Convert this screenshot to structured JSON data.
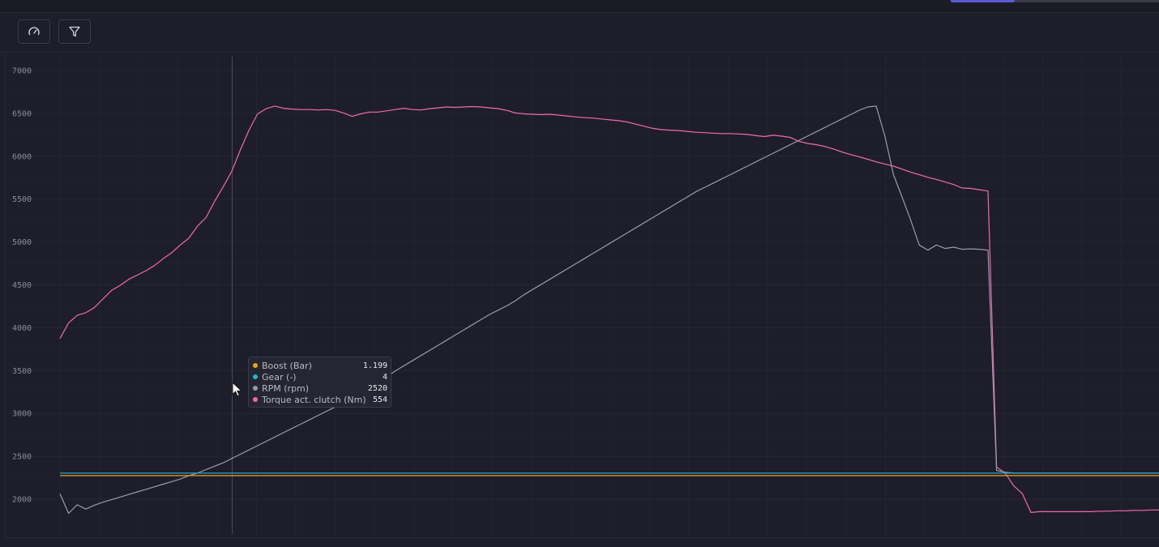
{
  "toolbar": {
    "buttons": [
      {
        "icon": "gauge-icon"
      },
      {
        "icon": "filter-icon"
      }
    ]
  },
  "tooltip": {
    "rows": [
      {
        "label": "Boost (Bar)",
        "value": "1.199",
        "color": "#f0a020"
      },
      {
        "label": "Gear (-)",
        "value": "4",
        "color": "#22b8cf"
      },
      {
        "label": "RPM (rpm)",
        "value": "2520",
        "color": "#9a9aae"
      },
      {
        "label": "Torque act. clutch (Nm)",
        "value": "554",
        "color": "#f06ab0"
      }
    ]
  },
  "chart_data": {
    "type": "line",
    "title": "",
    "xlabel": "",
    "ylabel": "",
    "ylim": [
      1700,
      7150
    ],
    "xlim": [
      0,
      128
    ],
    "y_ticks": [
      2000,
      2500,
      3000,
      3500,
      4000,
      4500,
      5000,
      5500,
      6000,
      6500,
      7000
    ],
    "grid": true,
    "cursor_x": 20,
    "series": [
      {
        "name": "Torque act. clutch (Nm)",
        "color": "#f06ab0",
        "points": [
          [
            0,
            3870
          ],
          [
            1,
            4050
          ],
          [
            2,
            4140
          ],
          [
            3,
            4170
          ],
          [
            4,
            4230
          ],
          [
            5,
            4330
          ],
          [
            6,
            4430
          ],
          [
            7,
            4490
          ],
          [
            8,
            4560
          ],
          [
            9,
            4610
          ],
          [
            10,
            4660
          ],
          [
            11,
            4720
          ],
          [
            12,
            4800
          ],
          [
            13,
            4870
          ],
          [
            14,
            4960
          ],
          [
            15,
            5040
          ],
          [
            16,
            5180
          ],
          [
            17,
            5280
          ],
          [
            18,
            5470
          ],
          [
            19,
            5640
          ],
          [
            20,
            5820
          ],
          [
            21,
            6070
          ],
          [
            22,
            6300
          ],
          [
            23,
            6490
          ],
          [
            24,
            6550
          ],
          [
            25,
            6580
          ],
          [
            26,
            6555
          ],
          [
            27,
            6545
          ],
          [
            28,
            6540
          ],
          [
            29,
            6540
          ],
          [
            30,
            6535
          ],
          [
            31,
            6540
          ],
          [
            32,
            6530
          ],
          [
            33,
            6500
          ],
          [
            34,
            6460
          ],
          [
            35,
            6490
          ],
          [
            36,
            6510
          ],
          [
            37,
            6510
          ],
          [
            38,
            6525
          ],
          [
            39,
            6540
          ],
          [
            40,
            6555
          ],
          [
            41,
            6540
          ],
          [
            42,
            6535
          ],
          [
            43,
            6550
          ],
          [
            44,
            6560
          ],
          [
            45,
            6570
          ],
          [
            46,
            6565
          ],
          [
            47,
            6570
          ],
          [
            48,
            6575
          ],
          [
            49,
            6570
          ],
          [
            50,
            6560
          ],
          [
            51,
            6550
          ],
          [
            52,
            6530
          ],
          [
            53,
            6500
          ],
          [
            54,
            6490
          ],
          [
            55,
            6485
          ],
          [
            56,
            6480
          ],
          [
            57,
            6485
          ],
          [
            58,
            6475
          ],
          [
            59,
            6465
          ],
          [
            60,
            6455
          ],
          [
            61,
            6445
          ],
          [
            62,
            6440
          ],
          [
            63,
            6430
          ],
          [
            64,
            6420
          ],
          [
            65,
            6410
          ],
          [
            66,
            6395
          ],
          [
            67,
            6370
          ],
          [
            68,
            6345
          ],
          [
            69,
            6320
          ],
          [
            70,
            6305
          ],
          [
            71,
            6300
          ],
          [
            72,
            6295
          ],
          [
            73,
            6285
          ],
          [
            74,
            6275
          ],
          [
            75,
            6270
          ],
          [
            76,
            6265
          ],
          [
            77,
            6260
          ],
          [
            78,
            6260
          ],
          [
            79,
            6255
          ],
          [
            80,
            6250
          ],
          [
            81,
            6235
          ],
          [
            82,
            6225
          ],
          [
            83,
            6240
          ],
          [
            84,
            6230
          ],
          [
            85,
            6215
          ],
          [
            86,
            6170
          ],
          [
            87,
            6145
          ],
          [
            88,
            6130
          ],
          [
            89,
            6110
          ],
          [
            90,
            6080
          ],
          [
            91,
            6045
          ],
          [
            92,
            6015
          ],
          [
            93,
            5990
          ],
          [
            94,
            5960
          ],
          [
            95,
            5930
          ],
          [
            96,
            5905
          ],
          [
            97,
            5880
          ],
          [
            98,
            5845
          ],
          [
            99,
            5810
          ],
          [
            100,
            5780
          ],
          [
            101,
            5750
          ],
          [
            102,
            5725
          ],
          [
            103,
            5695
          ],
          [
            104,
            5665
          ],
          [
            105,
            5625
          ],
          [
            106,
            5620
          ],
          [
            107,
            5605
          ],
          [
            108,
            5590
          ],
          [
            109,
            2370
          ],
          [
            110,
            2300
          ],
          [
            111,
            2150
          ],
          [
            112,
            2060
          ],
          [
            113,
            1840
          ],
          [
            114,
            1850
          ],
          [
            115,
            1850
          ],
          [
            116,
            1850
          ],
          [
            117,
            1850
          ],
          [
            118,
            1850
          ],
          [
            119,
            1850
          ],
          [
            120,
            1850
          ],
          [
            121,
            1855
          ],
          [
            122,
            1855
          ],
          [
            123,
            1860
          ],
          [
            124,
            1860
          ],
          [
            125,
            1865
          ],
          [
            126,
            1865
          ],
          [
            127,
            1870
          ],
          [
            128,
            1870
          ]
        ]
      },
      {
        "name": "RPM (rpm)",
        "color": "#9a9aae",
        "points": [
          [
            0,
            2060
          ],
          [
            1,
            1830
          ],
          [
            2,
            1930
          ],
          [
            3,
            1880
          ],
          [
            4,
            1925
          ],
          [
            5,
            1960
          ],
          [
            6,
            1990
          ],
          [
            7,
            2020
          ],
          [
            8,
            2050
          ],
          [
            9,
            2080
          ],
          [
            10,
            2110
          ],
          [
            11,
            2140
          ],
          [
            12,
            2170
          ],
          [
            13,
            2200
          ],
          [
            14,
            2230
          ],
          [
            15,
            2270
          ],
          [
            16,
            2300
          ],
          [
            17,
            2340
          ],
          [
            18,
            2380
          ],
          [
            19,
            2420
          ],
          [
            20,
            2470
          ],
          [
            21,
            2520
          ],
          [
            22,
            2570
          ],
          [
            23,
            2620
          ],
          [
            24,
            2670
          ],
          [
            25,
            2720
          ],
          [
            26,
            2770
          ],
          [
            27,
            2820
          ],
          [
            28,
            2870
          ],
          [
            29,
            2920
          ],
          [
            30,
            2970
          ],
          [
            31,
            3020
          ],
          [
            32,
            3070
          ],
          [
            33,
            3120
          ],
          [
            34,
            3170
          ],
          [
            35,
            3230
          ],
          [
            36,
            3290
          ],
          [
            37,
            3350
          ],
          [
            38,
            3420
          ],
          [
            39,
            3490
          ],
          [
            40,
            3550
          ],
          [
            41,
            3610
          ],
          [
            42,
            3670
          ],
          [
            43,
            3730
          ],
          [
            44,
            3790
          ],
          [
            45,
            3850
          ],
          [
            46,
            3910
          ],
          [
            47,
            3970
          ],
          [
            48,
            4030
          ],
          [
            49,
            4090
          ],
          [
            50,
            4150
          ],
          [
            51,
            4200
          ],
          [
            52,
            4250
          ],
          [
            53,
            4310
          ],
          [
            54,
            4380
          ],
          [
            55,
            4440
          ],
          [
            56,
            4500
          ],
          [
            57,
            4560
          ],
          [
            58,
            4620
          ],
          [
            59,
            4680
          ],
          [
            60,
            4740
          ],
          [
            61,
            4800
          ],
          [
            62,
            4860
          ],
          [
            63,
            4920
          ],
          [
            64,
            4980
          ],
          [
            65,
            5040
          ],
          [
            66,
            5100
          ],
          [
            67,
            5160
          ],
          [
            68,
            5220
          ],
          [
            69,
            5280
          ],
          [
            70,
            5340
          ],
          [
            71,
            5400
          ],
          [
            72,
            5460
          ],
          [
            73,
            5520
          ],
          [
            74,
            5580
          ],
          [
            75,
            5630
          ],
          [
            76,
            5680
          ],
          [
            77,
            5730
          ],
          [
            78,
            5780
          ],
          [
            79,
            5830
          ],
          [
            80,
            5880
          ],
          [
            81,
            5930
          ],
          [
            82,
            5980
          ],
          [
            83,
            6030
          ],
          [
            84,
            6080
          ],
          [
            85,
            6130
          ],
          [
            86,
            6180
          ],
          [
            87,
            6230
          ],
          [
            88,
            6280
          ],
          [
            89,
            6330
          ],
          [
            90,
            6380
          ],
          [
            91,
            6430
          ],
          [
            92,
            6480
          ],
          [
            93,
            6530
          ],
          [
            94,
            6570
          ],
          [
            95,
            6580
          ],
          [
            96,
            6230
          ],
          [
            97,
            5780
          ],
          [
            98,
            5520
          ],
          [
            99,
            5250
          ],
          [
            100,
            4960
          ],
          [
            101,
            4900
          ],
          [
            102,
            4960
          ],
          [
            103,
            4920
          ],
          [
            104,
            4935
          ],
          [
            105,
            4910
          ],
          [
            106,
            4915
          ],
          [
            107,
            4910
          ],
          [
            108,
            4900
          ],
          [
            109,
            2330
          ],
          [
            110,
            2310
          ],
          [
            111,
            2300
          ],
          [
            112,
            2300
          ],
          [
            113,
            2300
          ],
          [
            114,
            2300
          ],
          [
            115,
            2300
          ],
          [
            116,
            2300
          ],
          [
            117,
            2300
          ],
          [
            118,
            2300
          ],
          [
            119,
            2300
          ],
          [
            120,
            2300
          ],
          [
            121,
            2300
          ],
          [
            122,
            2300
          ],
          [
            123,
            2300
          ],
          [
            124,
            2300
          ],
          [
            125,
            2300
          ],
          [
            126,
            2300
          ],
          [
            127,
            2300
          ],
          [
            128,
            2300
          ]
        ]
      },
      {
        "name": "Gear (-)",
        "color": "#22b8cf",
        "points": [
          [
            0,
            2300
          ],
          [
            128,
            2300
          ]
        ]
      },
      {
        "name": "Boost (Bar)",
        "color": "#f0a020",
        "points": [
          [
            0,
            2270
          ],
          [
            128,
            2270
          ]
        ]
      }
    ]
  }
}
